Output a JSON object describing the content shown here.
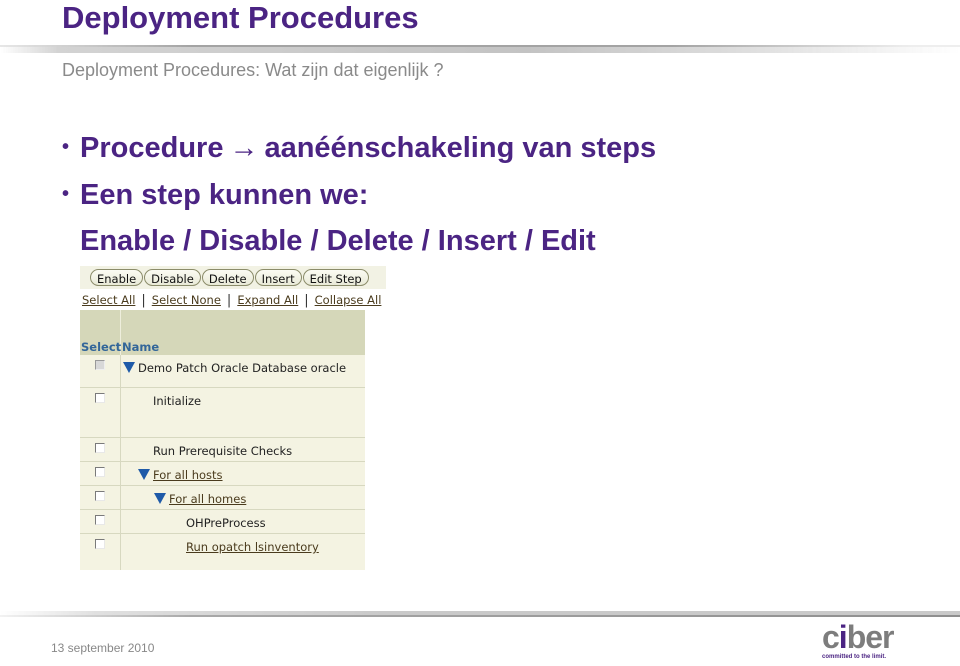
{
  "slide": {
    "title": "Deployment Procedures",
    "subtitle": "Deployment Procedures: Wat zijn dat eigenlijk ?",
    "bullets": [
      {
        "bullet": "•",
        "text_before": "Procedure",
        "arrow": "→",
        "text_after": "aanéénschakeling van steps"
      },
      {
        "bullet": "•",
        "text": "Een step kunnen we:"
      },
      {
        "text": "Enable / Disable / Delete / Insert / Edit"
      }
    ],
    "footer_date": "13 september 2010",
    "logo": {
      "wordmark_before": "c",
      "wordmark_i": "i",
      "wordmark_after": "ber",
      "tagline": "committed to the limit."
    }
  },
  "oracle_ui": {
    "buttons": [
      "Enable",
      "Disable",
      "Delete",
      "Insert",
      "Edit Step"
    ],
    "links": [
      "Select All",
      "Select None",
      "Expand All",
      "Collapse All"
    ],
    "link_separator": "|",
    "columns": {
      "select": "Select",
      "name": "Name"
    },
    "rows": [
      {
        "name": "Demo Patch Oracle Database oracle",
        "level": 0,
        "expandable": true,
        "link": false,
        "checkbox_disabled": true
      },
      {
        "name": "Initialize",
        "level": 1,
        "expandable": false,
        "link": false,
        "checkbox_disabled": false
      },
      {
        "name": "Run Prerequisite Checks",
        "level": 1,
        "expandable": false,
        "link": false,
        "checkbox_disabled": false
      },
      {
        "name": "For all hosts",
        "level": 1,
        "expandable": true,
        "link": true,
        "checkbox_disabled": false
      },
      {
        "name": "For all homes",
        "level": 2,
        "expandable": true,
        "link": true,
        "checkbox_disabled": false
      },
      {
        "name": "OHPreProcess",
        "level": 3,
        "expandable": false,
        "link": false,
        "checkbox_disabled": false
      },
      {
        "name": "Run opatch lsinventory",
        "level": 3,
        "expandable": false,
        "link": true,
        "checkbox_disabled": false
      }
    ]
  },
  "colors": {
    "title": "#4b2483",
    "subtitle": "#8a8a8a",
    "table_header": "#d5d7b9",
    "table_body": "#f4f3e2",
    "column_header_text": "#336699",
    "expand_triangle": "#1e5aa8"
  }
}
